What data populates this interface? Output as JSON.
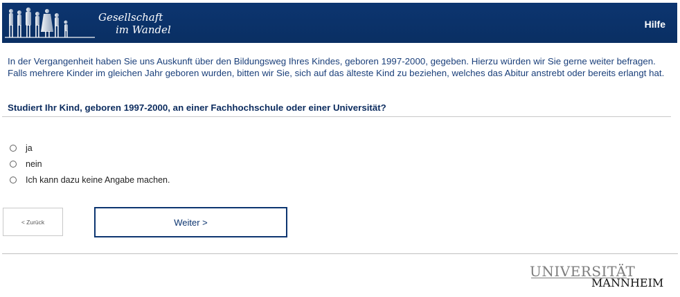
{
  "header": {
    "logo_line1": "Gesellschaft",
    "logo_line2": "im Wandel",
    "help_label": "Hilfe"
  },
  "intro_text": "In der Vergangenheit haben Sie uns Auskunft über den Bildungsweg Ihres Kindes, geboren 1997-2000, gegeben. Hierzu würden wir Sie gerne weiter befragen. Falls mehrere Kinder im gleichen Jahr geboren wurden, bitten wir Sie, sich auf das älteste Kind zu beziehen, welches das Abitur anstrebt oder bereits erlangt hat.",
  "question": "Studiert Ihr Kind, geboren 1997-2000, an einer Fachhochschule oder einer Universität?",
  "options": [
    {
      "label": "ja"
    },
    {
      "label": "nein"
    },
    {
      "label": "Ich kann dazu keine Angabe machen."
    }
  ],
  "buttons": {
    "back_label": "< Zurück",
    "next_label": "Weiter >"
  },
  "footer": {
    "uni_word1": "UNIVERSITÄT",
    "uni_word2": "MANNHEIM"
  },
  "colors": {
    "header_bg": "#0c3570",
    "text_blue": "#1a3f7a"
  }
}
